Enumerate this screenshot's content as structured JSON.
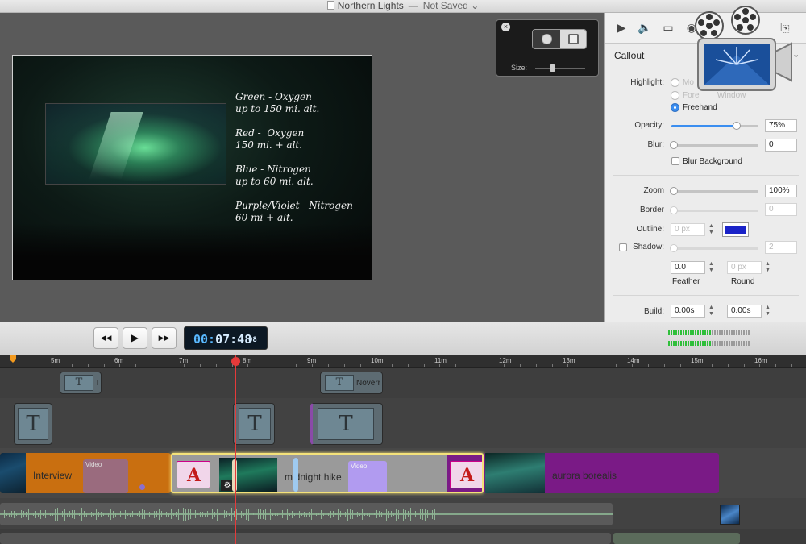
{
  "window": {
    "title": "Northern Lights",
    "separator": "—",
    "save_state": "Not Saved",
    "save_chevron": "⌄"
  },
  "canvas": {
    "overlay_lines": [
      "Green - Oxygen\nup to 150 mi. alt.",
      "Red -  Oxygen\n150 mi. + alt.",
      "Blue - Nitrogen\nup to 60 mi. alt.",
      "Purple/Violet - Nitrogen\n60 mi + alt."
    ]
  },
  "shape_popup": {
    "close_glyph": "×",
    "size_label": "Size:"
  },
  "inspector": {
    "tabs": [
      "▶",
      "🔈",
      "▭",
      "◉",
      "⎘"
    ],
    "section_title": "Callout",
    "section_chevron": "⌄",
    "highlight_label": "Highlight:",
    "highlight_options": [
      {
        "label": "Mo",
        "selected": false
      },
      {
        "label": "Fore        Window",
        "selected": false
      },
      {
        "label": "Freehand",
        "selected": true
      }
    ],
    "opacity_label": "Opacity:",
    "opacity_value": "75%",
    "opacity_level": 0.75,
    "blur_label": "Blur:",
    "blur_value": "0",
    "blur_background_label": "Blur Background",
    "zoom_label": "Zoom",
    "zoom_value": "100%",
    "border_label": "Border",
    "border_value": "0",
    "outline_label": "Outline:",
    "outline_value": "0 px",
    "outline_color": "#1a23c8",
    "shadow_label": "Shadow:",
    "shadow_value": "2",
    "feather_value": "0.0",
    "feather_label": "Feather",
    "round_value": "0 px",
    "round_label": "Round",
    "build_label": "Build:",
    "build_in": "0.00s",
    "build_out": "0.00s"
  },
  "transport": {
    "rewind_glyph": "◀◀",
    "play_glyph": "▶",
    "forward_glyph": "▶▶",
    "timecode_dim": "00:",
    "timecode_bright": "07:48",
    "timecode_frames": "08"
  },
  "ruler": {
    "labels": [
      "5m",
      "6m",
      "7m",
      "8m",
      "9m",
      "10m",
      "11m",
      "12m",
      "13m",
      "14m",
      "15m",
      "16m"
    ]
  },
  "timeline": {
    "title_clip_1_text": "T",
    "title_clip_2_text": "Noverr",
    "title_glyph": "T",
    "clips": {
      "interview": "Interview",
      "midnight_hike": "midnight hike",
      "aurora_borealis": "aurora borealis",
      "video_chip": "Video"
    }
  },
  "colors": {
    "accent": "#3b8ef0",
    "playhead": "#e53a3a",
    "orange_clip": "#c96f10",
    "purple_clip": "#7a1a86"
  }
}
